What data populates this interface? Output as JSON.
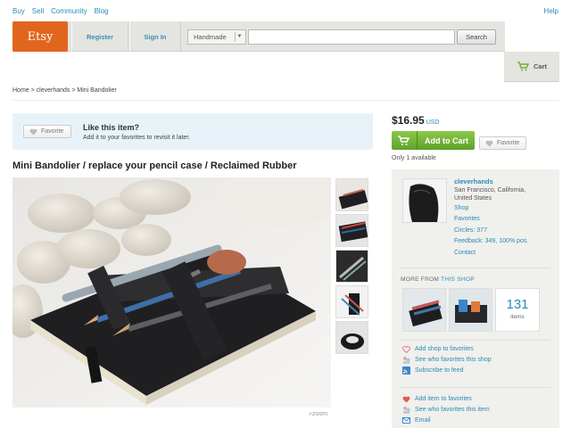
{
  "topnav": {
    "links": [
      "Buy",
      "Sell",
      "Community",
      "Blog"
    ],
    "help": "Help"
  },
  "header": {
    "logo": "Etsy",
    "register": "Register",
    "signin": "Sign In",
    "search_category": "Handmade",
    "search_placeholder": "",
    "search_button": "Search",
    "cart": "Cart"
  },
  "breadcrumb": "Home > cleverhands > Mini Bandolier",
  "likebox": {
    "favorite": "Favorite",
    "title": "Like this item?",
    "subtitle": "Add it to your favorites to revisit it later."
  },
  "item": {
    "title": "Mini Bandolier / replace your pencil case / Reclaimed Rubber",
    "zoom": "zoom"
  },
  "purchase": {
    "price": "$16.95",
    "currency": "USD",
    "add_to_cart": "Add to Cart",
    "favorite": "Favorite",
    "availability": "Only 1 available"
  },
  "shop": {
    "name": "cleverhands",
    "location": "San Francisco, California, United States",
    "links": [
      "Shop",
      "Favorites",
      "Circles: 377",
      "Feedback: 349, 100% pos.",
      "Contact"
    ],
    "more_from_prefix": "MORE FROM",
    "more_from_link": "THIS SHOP",
    "item_count": "131",
    "item_count_label": "items",
    "shop_actions": [
      "Add shop to favorites",
      "See who favorites this shop",
      "Subscribe to feed"
    ],
    "item_actions": [
      "Add item to favorites",
      "See who favorites this item",
      "Email"
    ]
  },
  "colors": {
    "brand": "#e1661d",
    "link": "#2a8ab8",
    "cart_green": "#6fb236",
    "like_bg": "#e8f3f9"
  },
  "icons": [
    "heart-icon",
    "cart-icon",
    "rss-icon",
    "mail-icon",
    "zoom-icon"
  ]
}
